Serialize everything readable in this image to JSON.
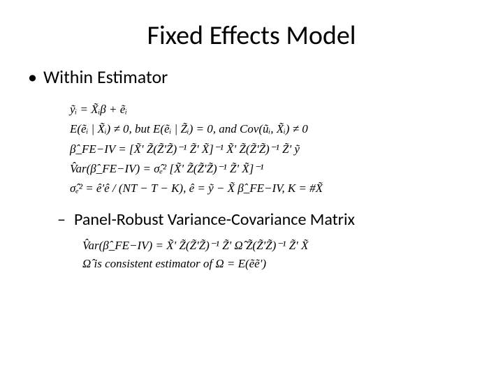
{
  "title": "Fixed Effects Model",
  "bullet1": "Within Estimator",
  "math1": {
    "l1": "ỹᵢ = X̃ᵢβ + ẽᵢ",
    "l2": "E(ẽᵢ | X̃ᵢ) ≠ 0, but E(ẽᵢ | Z̃ᵢ) = 0, and Cov(ũᵢ, X̃ᵢ) ≠ 0",
    "l3": "β̂_FE−IV = [X̃' Z̃(Z̃'Z̃)⁻¹ Z̃' X̃]⁻¹ X̃' Z̃(Z̃'Z̃)⁻¹ Z̃' ỹ",
    "l4": "V̂ar(β̂_FE−IV) = σ̂ₑ² [X̃' Z̃(Z̃'Z̃)⁻¹ Z̃' X̃]⁻¹",
    "l5": "σ̂ₑ² = ê'ê / (NT − T − K),  ê = ỹ − X̃ β̂_FE−IV,  K = #X̃"
  },
  "bullet2": "Panel-Robust Variance-Covariance Matrix",
  "math2": {
    "l1": "V̂ar(β̂_FE−IV) = X̃' Z̃(Z̃'Z̃)⁻¹ Z̃' Ω̂ Z̃(Z̃'Z̃)⁻¹ Z̃' X̃",
    "l2": "Ω̂ is consistent estimator of Ω = E(ẽẽ')"
  }
}
